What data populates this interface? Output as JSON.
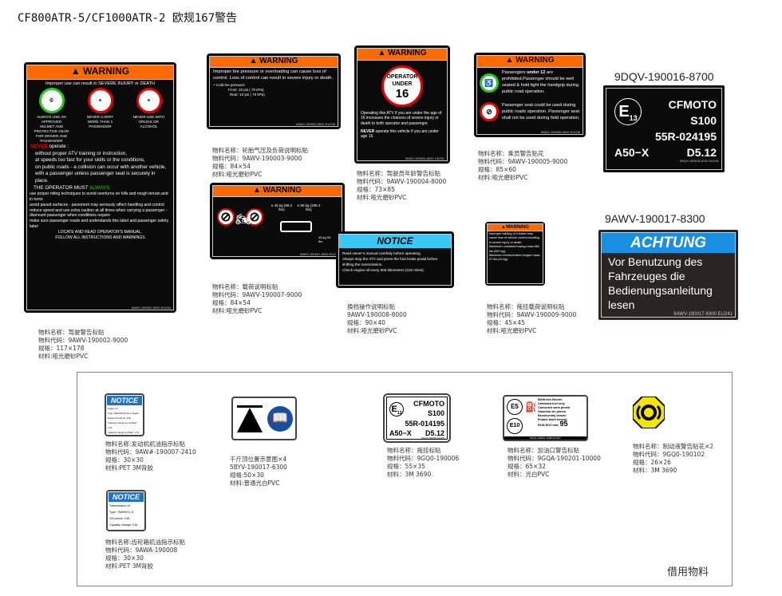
{
  "title": "CF800ATR-5/CF1000ATR-2 欧规167警告",
  "main_warning": {
    "header": "WARNING",
    "intro": "Improper use can result in SEVERE INJURY or DEATH",
    "icons": [
      "ALWAYS USE AN APPROVED HELMET AND PROTECTIVE GEAR FOR DRIVER AND PASSENGER",
      "NEVER CARRY MORE THAN 1 PASSENGER",
      "NEVER USE WITH DRUGS OR ALCOHOL"
    ],
    "never": "NEVER",
    "never_rest": " operate :",
    "never_items": [
      "without proper ATV training or instruction,",
      "at speeds too fast for your skills or the conditions,",
      "on public roads - a collision can occur with another vehicle,",
      "with a passenger unless passenger seat is securely in place."
    ],
    "must": "THE OPERATOR MUST ",
    "always": "ALWAYS:",
    "must_items": [
      "use proper riding techniques to avoid overturns on hills and rough terrain and in turns",
      "avoid paved surfaces - pavement may seriously affect handling and control",
      "reduce speed and use extra caution at all times when carrying a passenger - dismount passenger when conditions require",
      "make sure passenger reads and understands this label and passenger safety label"
    ],
    "footer1": "LOCATE AND READ OPERATOR'S MANUAL.",
    "footer2": "FOLLOW ALL INSTRUCTIONS AND WARNINGS",
    "code": "9AWV-190002-9000  EU234",
    "caption": [
      "物料名称：驾驶警告标贴",
      "物料代码：9AWV-190002-9000",
      "规格：117×178",
      "材料:哑光磨砂PVC"
    ]
  },
  "tire_warning": {
    "header": "WARNING",
    "text": "Improper tire pressure or overloading can cause loss of control. Loss of control can result in severe injury or death.",
    "cold": "• Cold tire pressure:",
    "front": "Front: 10 psi ( 70 kPa)",
    "rear": "Rear: 10 psi ( 70 kPa)",
    "code": "9AWV-190003-9000  EU238",
    "caption": [
      "物料名称：轮胎气压及负荷说明标贴",
      "物料代码：9AWV-190003-9000",
      "规格：84×54",
      "材料:哑光磨砂PVC"
    ]
  },
  "load_warning": {
    "header": "WARNING",
    "load1": "≤ 45 kg (99.2 lbs)",
    "load2": "≤ 90 kg (198.4 lbs)",
    "hitch": "45 kg 99 lbs",
    "code": "9AWV-190007-9000  EU238",
    "caption": [
      "物料名称：载荷说明标贴",
      "物料代码：9AWV-190007-9000",
      "规格：84×54",
      "材料:哑光磨砂PVC"
    ]
  },
  "age_warning": {
    "header": "WARNING",
    "circle1": "OPERATOR",
    "circle2": "UNDER",
    "circle3": "16",
    "text": "Operating this ATV if you are under the age of 16 increases the chances of severe injury or death to both operator and passenger.",
    "never": "NEVER",
    "never_rest": " operate this vehicle if you are under age 16.",
    "code": "9AWV-190004-8000  US231",
    "caption": [
      "物料名称：驾驶员年龄警告标贴",
      "物料代码：9AWV-190004-8000",
      "规格：73×85",
      "材料:哑光磨砂PVC"
    ]
  },
  "passenger_warning": {
    "header": "WARNING",
    "text1a": "Passengers ",
    "text1b": "under 12",
    "text1c": " are prohibited.Passenger should be well seated & hold tight the handgrip during public road operation.",
    "text2": "Passenger seat could be used during public roads operation. Passenger seat shall not be used during field operation.",
    "code": "9AWV-190005-9000  EU236",
    "caption": [
      "物料名称：乘员警告贴花",
      "物料代码：9AWV-190005-9000",
      "规格：85×60",
      "材料:哑光磨砂PVC"
    ]
  },
  "homologation": {
    "part_code": "9DQV-190016-8700",
    "mark": "E",
    "mark_sub": "13",
    "brand": "CFMOTO",
    "model": "S100",
    "approval": "55R-024195",
    "class": "A50−X",
    "value": "D5.12",
    "code": "9DQV-190016-8700  EU241"
  },
  "achtung": {
    "part_code": "9AWV-190017-8300",
    "header": "ACHTUNG",
    "text": "Vor Benutzung des Fahrzeuges die Bedienungsanleitung lesen",
    "code": "9AWV-190017-8300  EU241"
  },
  "notice": {
    "header": "NOTICE",
    "items": [
      "Read owner’s manual carefully before operating.",
      "Always stop the ATV and press the foot brake pedal before shifting the transmission.",
      "Check engine oil every 500 kilometers (310 miles)."
    ],
    "caption": [
      "换档操作说明标贴",
      "9AWV-190008-8000",
      "规格：90×40",
      "材料:哑光磨砂PVC"
    ]
  },
  "trailer_warning": {
    "header": "WARNING",
    "text": "Improper loading of a trailer may cause loss of vehicle control,resulting in severe injury or death.",
    "item1": "Maximum unbraked towing mass 660 lbs.(300 kg).",
    "item2": "Maximum inertia-braked tongue mass 97 lbs.(44 kg).",
    "caption": [
      "物料名称：拖挂载荷说明标贴",
      "物料代码：9AWV-190009-9000",
      "规格：45×45",
      "材料:哑光磨砂PVC"
    ]
  },
  "borrowed": {
    "label": "借用物料",
    "engine_notice": {
      "header": "NOTICE",
      "lines": [
        "Engine oil",
        "Type: SAE10W-40 SJ or higher",
        "Engine oil volume: 2.8L",
        "Capacity change (no oil filter): 2.4L",
        "Capacity change (oil filter): 2.5 L"
      ],
      "caption": [
        "物料名称:发动机机油指示标贴",
        "物料代码：9AW#-190007-2410",
        "规格：30×30",
        "材料:PET 3M背胶"
      ]
    },
    "jack": {
      "caption": [
        "千斤顶位置示意图×4",
        "5BYV-190017-6300",
        "规格:50×30",
        "材料:普通光白PVC"
      ]
    },
    "homologation_small": {
      "mark": "E",
      "mark_sub": "13",
      "brand": "CFMOTO",
      "model": "S100",
      "approval": "55R-014195",
      "class": "A50−X",
      "value": "D5.12",
      "code": "9GQ0-190006  EU206",
      "caption": [
        "物料名称：拖挂标贴",
        "物料代码：9GQ0-190006",
        "规格：55×35",
        "材料：3M 3690"
      ]
    },
    "fuel": {
      "e5": "E5",
      "e10": "E10",
      "lines": [
        "Bleifreies Benzin",
        "Unleaded fuel only",
        "Carburant sans plomb",
        "Gasolina sin plomo",
        "Bezolovnatý benzin",
        "Endast blyfri bensin"
      ],
      "ron": "RON ROZ min.",
      "ron_val": "95",
      "code": "9GQA-190201-10000  EU157",
      "caption": [
        "物料名称：加油口警告标贴",
        "物料代码：9GQA-190201-10000",
        "规格：65×32",
        "材料：光白PVC"
      ]
    },
    "brake": {
      "color": "#f5e400",
      "caption": [
        "物料名称：制动液警告贴花×2",
        "物料代码：9GQ0-190102",
        "规格：26×26",
        "材料：3M 3690"
      ]
    },
    "gear_notice": {
      "header": "NOTICE",
      "lines": [
        "Transmission oil:",
        "Type: 75W90/GL-5",
        "Oil volume: 0.8L",
        "Capacity change: 0.8L"
      ],
      "caption": [
        "物料名称:齿轮箱机油指示标贴",
        "物料代码：9AWA-190008",
        "规格：30×30",
        "材料:PET 3M背胶"
      ]
    }
  },
  "colors": {
    "warning_orange": "#ff6a00",
    "notice_blue": "#3cc8f5",
    "achtung_blue": "#1a8fe0",
    "never_red": "#e00000",
    "always_green": "#22cc22"
  }
}
